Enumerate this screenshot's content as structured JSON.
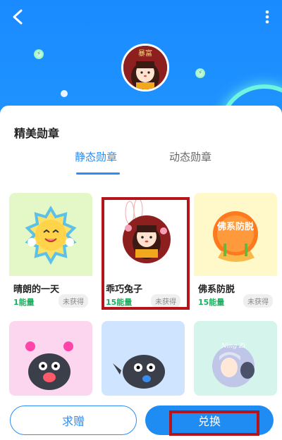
{
  "panel": {
    "title": "精美勋章",
    "tabs": [
      {
        "label": "静态勋章",
        "active": true
      },
      {
        "label": "动态勋章",
        "active": false
      }
    ]
  },
  "medals": [
    {
      "name": "晴朗的一天",
      "energy": "1能量",
      "status": "未获得",
      "bg": "#e4f7c6"
    },
    {
      "name": "乖巧兔子",
      "energy": "15能量",
      "status": "未获得",
      "bg": "#ffffff"
    },
    {
      "name": "佛系防脱",
      "energy": "15能量",
      "status": "未获得",
      "bg": "#fff8c8"
    },
    {
      "bg": "#fbd6ee"
    },
    {
      "bg": "#cfe4ff"
    },
    {
      "bg": "#d4f4ec"
    }
  ],
  "badge_text": {
    "rabbit_banner": "暴富",
    "anti_hair_loss": "佛系防脱",
    "ninja_label": "Ning Zi"
  },
  "footer": {
    "gift_label": "求赠",
    "exchange_label": "兑换"
  },
  "colors": {
    "accent": "#2b8df5",
    "energy": "#19b05f",
    "highlight": "#b3151a"
  }
}
